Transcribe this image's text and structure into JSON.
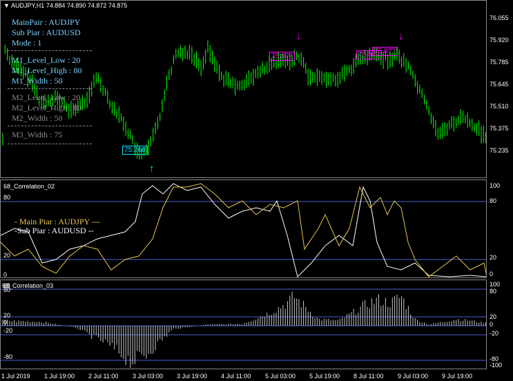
{
  "chart_header": {
    "symbol_tf": "AUDJPY,H1",
    "ohlc": "74.884 74.890 74.872 74.875"
  },
  "overlay": {
    "main_pair": "MainPair : AUDJPY",
    "sub_pair": "Sub Piar : AUDUSD",
    "mode": "Mode : 1",
    "m1_low": "M1_Level_Low : 20",
    "m1_high": "M1_Level_High : 80",
    "m1_width": "M1_Width : 50",
    "m2_low": "M2_Level_Low : 20",
    "m2_high": "M2_Level_High : 80",
    "m2_width": "M2_Width : 50",
    "m3_width": "M3_Width : 75"
  },
  "price_labels": [
    {
      "text": "75.268",
      "color": "#00e5ff"
    },
    {
      "text": "75.8??",
      "color": "#ff00ff"
    },
    {
      "text": "75.8??",
      "color": "#ff00ff"
    },
    {
      "text": "75.8??",
      "color": "#ff00ff"
    }
  ],
  "price_scale": [
    "76.055",
    "75.920",
    "75.785",
    "75.645",
    "75.510",
    "75.375",
    "75.235"
  ],
  "corr2": {
    "title": "68_Correlation_02",
    "legend_main": "- Main Piar : AUDJPY ---",
    "legend_sub": "-Sub Piar : AUDUSD --",
    "scale": [
      "100",
      "80",
      "20",
      "0"
    ],
    "left_levels": [
      "80",
      "20",
      "0"
    ],
    "colors": {
      "main": "#e8c84a",
      "sub": "#ffffff",
      "level": "#4b5fd8"
    }
  },
  "corr3": {
    "title": "68_Correlation_03",
    "title_prefix": "88",
    "scale": [
      "100",
      "80",
      "20",
      "0",
      "-20",
      "-80",
      "-100"
    ],
    "left_levels": [
      "80",
      "20",
      "0",
      "-20",
      "-80"
    ]
  },
  "x_axis": [
    "1 Jul 2019",
    "1 Jul 19:00",
    "2 Jul 11:00",
    "3 Jul 03:00",
    "3 Jul 19:00",
    "4 Jul 11:00",
    "5 Jul 03:00",
    "5 Jul 19:00",
    "8 Jul 11:00",
    "9 Jul 03:00",
    "9 Jul 19:00"
  ],
  "colors": {
    "bull": "#00ff00",
    "bear": "#00ff00",
    "bg": "#000000",
    "grid": "#8a8a8a"
  },
  "icons": {
    "signal_up": "up-arrow-icon",
    "signal_down": "down-arrow-icon",
    "menu": "triangle-down-icon"
  }
}
